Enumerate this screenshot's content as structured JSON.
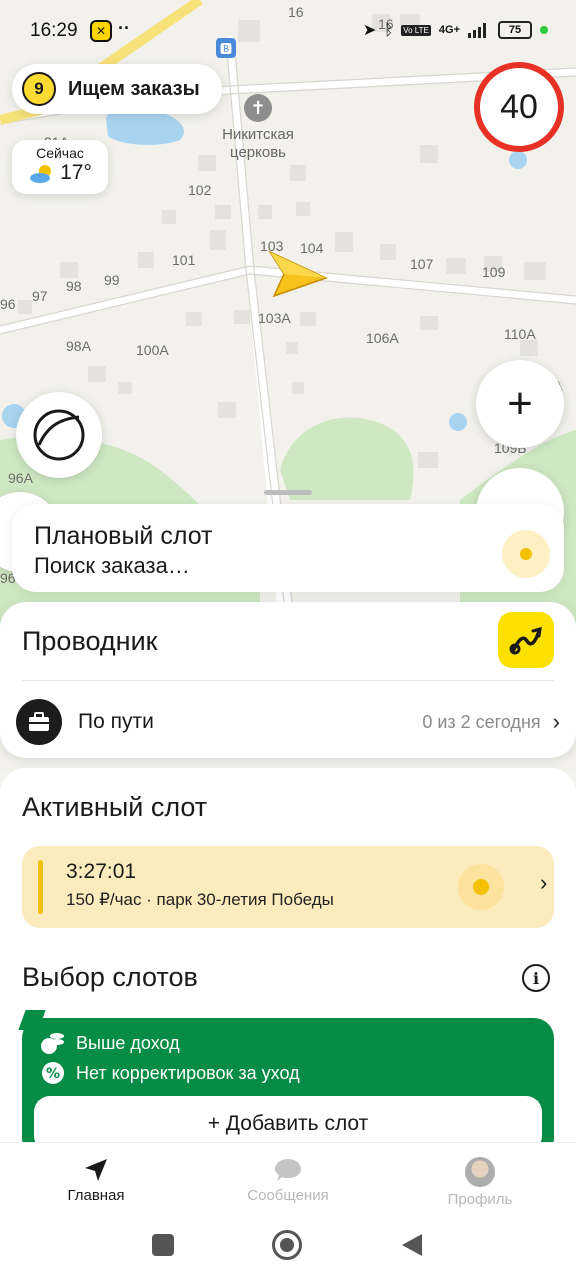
{
  "status_bar": {
    "time": "16:29",
    "dots": "··",
    "network": "4G+",
    "battery": "75"
  },
  "map": {
    "house_numbers": [
      "16",
      "16",
      "21А",
      "102",
      "103",
      "104",
      "107",
      "109",
      "101",
      "99",
      "98",
      "97",
      "96",
      "103А",
      "106А",
      "110А",
      "98А",
      "100А",
      "111А",
      "109Б",
      "96А",
      "96",
      "96"
    ],
    "poi": {
      "label": "Никитская\nцерковь",
      "icon": "church-icon"
    },
    "bus_stop_icon": "bus-stop-icon"
  },
  "status_pill": {
    "count": "9",
    "text": "Ищем заказы"
  },
  "weather": {
    "label": "Сейчас",
    "temp": "17°",
    "icon": "partly-sunny-icon"
  },
  "speed_limit": "40",
  "zoom_in_label": "+",
  "planned_slot": {
    "title": "Плановый слот",
    "subtitle": "Поиск заказа…"
  },
  "guide": {
    "title": "Проводник",
    "row_label": "По пути",
    "row_count": "0 из 2 сегодня",
    "chevron": "›"
  },
  "active_slot": {
    "section_title": "Активный слот",
    "time": "3:27:01",
    "info": "150 ₽/час · парк 30-летия Победы",
    "chevron": "›"
  },
  "slot_choice": {
    "section_title": "Выбор слотов",
    "info_icon": "i",
    "benefits": [
      "Выше доход",
      "Нет корректировок за уход"
    ],
    "add_button": "+ Добавить слот"
  },
  "bottom_nav": [
    {
      "label": "Главная",
      "icon": "navigation-arrow-icon",
      "active": true
    },
    {
      "label": "Сообщения",
      "icon": "chat-bubble-icon",
      "active": false
    },
    {
      "label": "Профиль",
      "icon": "avatar",
      "active": false
    }
  ],
  "colors": {
    "accent_yellow": "#fce000",
    "promo_green": "#078c46",
    "speed_red": "#e63124",
    "map_green": "#cfe8c3"
  }
}
